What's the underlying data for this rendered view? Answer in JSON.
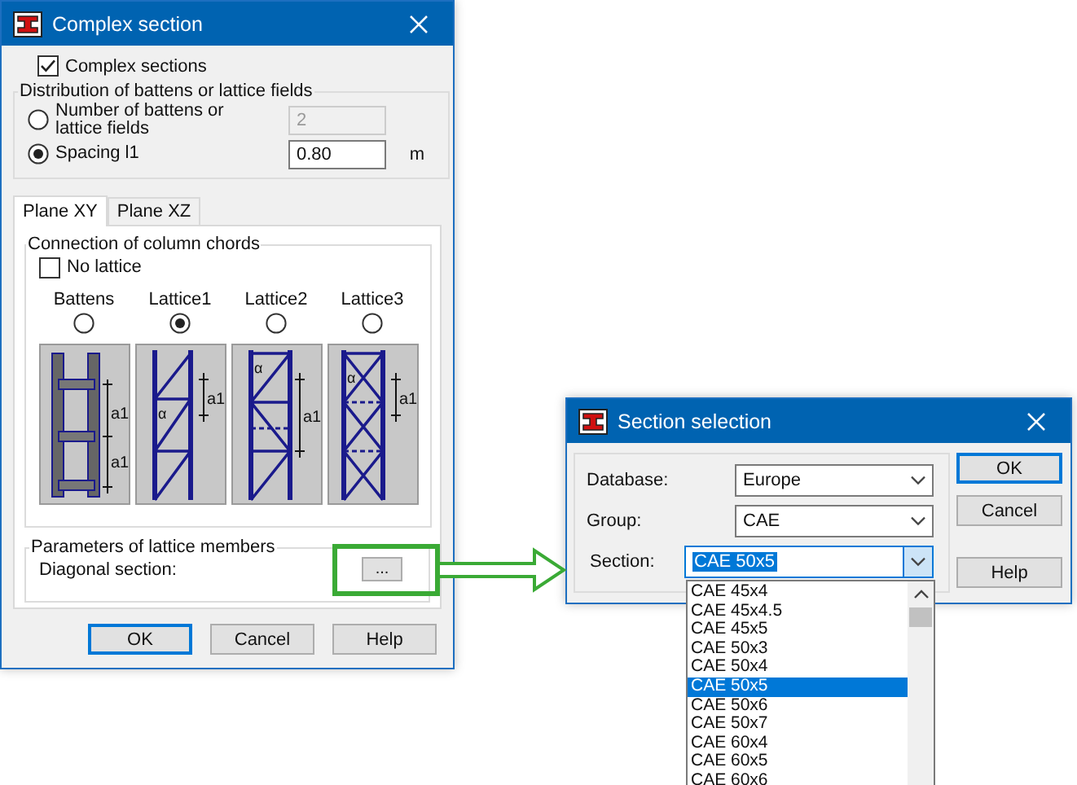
{
  "complex_dialog": {
    "title": "Complex section",
    "complex_sections": {
      "label": "Complex sections",
      "checked": true
    },
    "distribution": {
      "title": "Distribution of battens or lattice fields",
      "options": [
        {
          "label": "Number of battens or lattice fields",
          "selected": false,
          "value": "2",
          "disabled": true
        },
        {
          "label": "Spacing l1",
          "selected": true,
          "value": "0.80",
          "unit": "m",
          "disabled": false
        }
      ]
    },
    "tabs": [
      {
        "label": "Plane XY",
        "selected": true
      },
      {
        "label": "Plane XZ",
        "selected": false
      }
    ],
    "connection": {
      "title": "Connection of column chords",
      "no_lattice": {
        "label": "No lattice",
        "checked": false
      },
      "options": [
        {
          "label": "Battens",
          "selected": false,
          "kind": "battens",
          "dimension_labels": [
            "a1",
            "a1"
          ]
        },
        {
          "label": "Lattice1",
          "selected": true,
          "kind": "lattice1",
          "angle_label": "α",
          "dimension_labels": [
            "a1"
          ]
        },
        {
          "label": "Lattice2",
          "selected": false,
          "kind": "lattice2",
          "angle_label": "α",
          "dimension_labels": [
            "a1"
          ]
        },
        {
          "label": "Lattice3",
          "selected": false,
          "kind": "lattice3",
          "angle_label": "α",
          "dimension_labels": [
            "a1"
          ]
        }
      ]
    },
    "parameters": {
      "title": "Parameters of lattice members",
      "diagonal_label": "Diagonal section:",
      "browse_button": "...",
      "callout": true
    },
    "buttons": [
      "OK",
      "Cancel",
      "Help"
    ]
  },
  "section_dialog": {
    "title": "Section selection",
    "fields": [
      {
        "label": "Database:",
        "value": "Europe",
        "expanded": false
      },
      {
        "label": "Group:",
        "value": "CAE",
        "expanded": false
      },
      {
        "label": "Section:",
        "value": "CAE 50x5",
        "expanded": true
      }
    ],
    "list": [
      {
        "label": "CAE 45x4",
        "selected": false
      },
      {
        "label": "CAE 45x4.5",
        "selected": false
      },
      {
        "label": "CAE 45x5",
        "selected": false
      },
      {
        "label": "CAE 50x3",
        "selected": false
      },
      {
        "label": "CAE 50x4",
        "selected": false
      },
      {
        "label": "CAE 50x5",
        "selected": true
      },
      {
        "label": "CAE 50x6",
        "selected": false
      },
      {
        "label": "CAE 50x7",
        "selected": false
      },
      {
        "label": "CAE 60x4",
        "selected": false
      },
      {
        "label": "CAE 60x5",
        "selected": false
      },
      {
        "label": "CAE 60x6",
        "selected": false
      }
    ],
    "buttons": [
      "OK",
      "Cancel",
      "Help"
    ]
  }
}
